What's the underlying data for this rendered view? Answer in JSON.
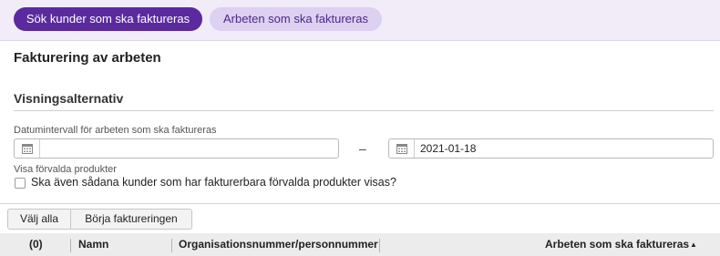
{
  "tabs": [
    {
      "label": "Sök kunder som ska faktureras",
      "active": true
    },
    {
      "label": "Arbeten som ska faktureras",
      "active": false
    }
  ],
  "page_title": "Fakturering av arbeten",
  "section_title": "Visningsalternativ",
  "date_range": {
    "label": "Datumintervall för arbeten som ska faktureras",
    "from_value": "",
    "separator": "–",
    "to_value": "2021-01-18"
  },
  "default_products": {
    "label": "Visa förvalda produkter",
    "checkbox_label": "Ska även sådana kunder som har fakturerbara förvalda produkter visas?",
    "checked": false
  },
  "actions": {
    "select_all": "Välj alla",
    "start_invoicing": "Börja faktureringen"
  },
  "table": {
    "columns": [
      {
        "label": "(0)"
      },
      {
        "label": "Namn"
      },
      {
        "label": "Organisationsnummer/personnummer"
      },
      {
        "label": "Arbeten som ska faktureras"
      }
    ],
    "sort_indicator": "▲"
  },
  "colors": {
    "accent": "#5a2a9e",
    "tab_inactive_bg": "#ddd0f1",
    "topbar_bg": "#f1ecf8"
  },
  "icons": [
    "calendar-icon"
  ]
}
